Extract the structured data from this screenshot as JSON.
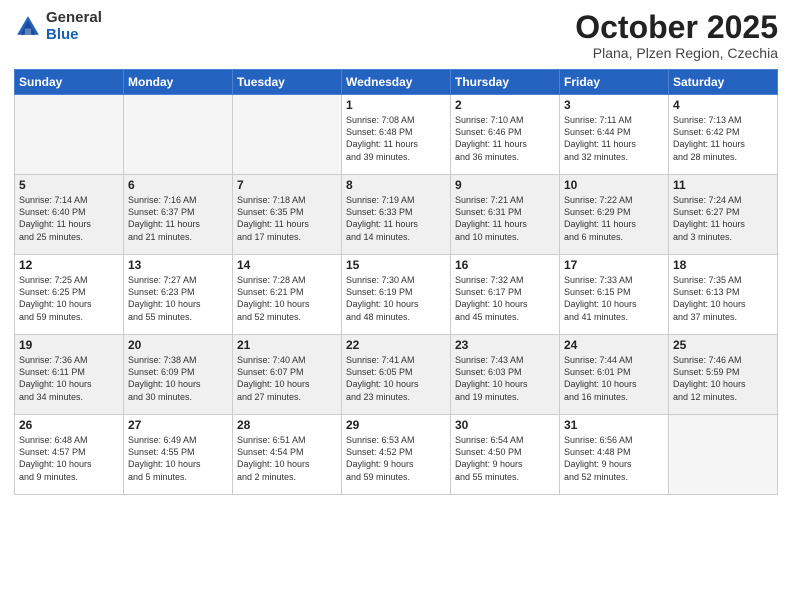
{
  "header": {
    "logo_general": "General",
    "logo_blue": "Blue",
    "month": "October 2025",
    "location": "Plana, Plzen Region, Czechia"
  },
  "days_of_week": [
    "Sunday",
    "Monday",
    "Tuesday",
    "Wednesday",
    "Thursday",
    "Friday",
    "Saturday"
  ],
  "weeks": [
    [
      {
        "day": "",
        "info": ""
      },
      {
        "day": "",
        "info": ""
      },
      {
        "day": "",
        "info": ""
      },
      {
        "day": "1",
        "info": "Sunrise: 7:08 AM\nSunset: 6:48 PM\nDaylight: 11 hours\nand 39 minutes."
      },
      {
        "day": "2",
        "info": "Sunrise: 7:10 AM\nSunset: 6:46 PM\nDaylight: 11 hours\nand 36 minutes."
      },
      {
        "day": "3",
        "info": "Sunrise: 7:11 AM\nSunset: 6:44 PM\nDaylight: 11 hours\nand 32 minutes."
      },
      {
        "day": "4",
        "info": "Sunrise: 7:13 AM\nSunset: 6:42 PM\nDaylight: 11 hours\nand 28 minutes."
      }
    ],
    [
      {
        "day": "5",
        "info": "Sunrise: 7:14 AM\nSunset: 6:40 PM\nDaylight: 11 hours\nand 25 minutes."
      },
      {
        "day": "6",
        "info": "Sunrise: 7:16 AM\nSunset: 6:37 PM\nDaylight: 11 hours\nand 21 minutes."
      },
      {
        "day": "7",
        "info": "Sunrise: 7:18 AM\nSunset: 6:35 PM\nDaylight: 11 hours\nand 17 minutes."
      },
      {
        "day": "8",
        "info": "Sunrise: 7:19 AM\nSunset: 6:33 PM\nDaylight: 11 hours\nand 14 minutes."
      },
      {
        "day": "9",
        "info": "Sunrise: 7:21 AM\nSunset: 6:31 PM\nDaylight: 11 hours\nand 10 minutes."
      },
      {
        "day": "10",
        "info": "Sunrise: 7:22 AM\nSunset: 6:29 PM\nDaylight: 11 hours\nand 6 minutes."
      },
      {
        "day": "11",
        "info": "Sunrise: 7:24 AM\nSunset: 6:27 PM\nDaylight: 11 hours\nand 3 minutes."
      }
    ],
    [
      {
        "day": "12",
        "info": "Sunrise: 7:25 AM\nSunset: 6:25 PM\nDaylight: 10 hours\nand 59 minutes."
      },
      {
        "day": "13",
        "info": "Sunrise: 7:27 AM\nSunset: 6:23 PM\nDaylight: 10 hours\nand 55 minutes."
      },
      {
        "day": "14",
        "info": "Sunrise: 7:28 AM\nSunset: 6:21 PM\nDaylight: 10 hours\nand 52 minutes."
      },
      {
        "day": "15",
        "info": "Sunrise: 7:30 AM\nSunset: 6:19 PM\nDaylight: 10 hours\nand 48 minutes."
      },
      {
        "day": "16",
        "info": "Sunrise: 7:32 AM\nSunset: 6:17 PM\nDaylight: 10 hours\nand 45 minutes."
      },
      {
        "day": "17",
        "info": "Sunrise: 7:33 AM\nSunset: 6:15 PM\nDaylight: 10 hours\nand 41 minutes."
      },
      {
        "day": "18",
        "info": "Sunrise: 7:35 AM\nSunset: 6:13 PM\nDaylight: 10 hours\nand 37 minutes."
      }
    ],
    [
      {
        "day": "19",
        "info": "Sunrise: 7:36 AM\nSunset: 6:11 PM\nDaylight: 10 hours\nand 34 minutes."
      },
      {
        "day": "20",
        "info": "Sunrise: 7:38 AM\nSunset: 6:09 PM\nDaylight: 10 hours\nand 30 minutes."
      },
      {
        "day": "21",
        "info": "Sunrise: 7:40 AM\nSunset: 6:07 PM\nDaylight: 10 hours\nand 27 minutes."
      },
      {
        "day": "22",
        "info": "Sunrise: 7:41 AM\nSunset: 6:05 PM\nDaylight: 10 hours\nand 23 minutes."
      },
      {
        "day": "23",
        "info": "Sunrise: 7:43 AM\nSunset: 6:03 PM\nDaylight: 10 hours\nand 19 minutes."
      },
      {
        "day": "24",
        "info": "Sunrise: 7:44 AM\nSunset: 6:01 PM\nDaylight: 10 hours\nand 16 minutes."
      },
      {
        "day": "25",
        "info": "Sunrise: 7:46 AM\nSunset: 5:59 PM\nDaylight: 10 hours\nand 12 minutes."
      }
    ],
    [
      {
        "day": "26",
        "info": "Sunrise: 6:48 AM\nSunset: 4:57 PM\nDaylight: 10 hours\nand 9 minutes."
      },
      {
        "day": "27",
        "info": "Sunrise: 6:49 AM\nSunset: 4:55 PM\nDaylight: 10 hours\nand 5 minutes."
      },
      {
        "day": "28",
        "info": "Sunrise: 6:51 AM\nSunset: 4:54 PM\nDaylight: 10 hours\nand 2 minutes."
      },
      {
        "day": "29",
        "info": "Sunrise: 6:53 AM\nSunset: 4:52 PM\nDaylight: 9 hours\nand 59 minutes."
      },
      {
        "day": "30",
        "info": "Sunrise: 6:54 AM\nSunset: 4:50 PM\nDaylight: 9 hours\nand 55 minutes."
      },
      {
        "day": "31",
        "info": "Sunrise: 6:56 AM\nSunset: 4:48 PM\nDaylight: 9 hours\nand 52 minutes."
      },
      {
        "day": "",
        "info": ""
      }
    ]
  ]
}
